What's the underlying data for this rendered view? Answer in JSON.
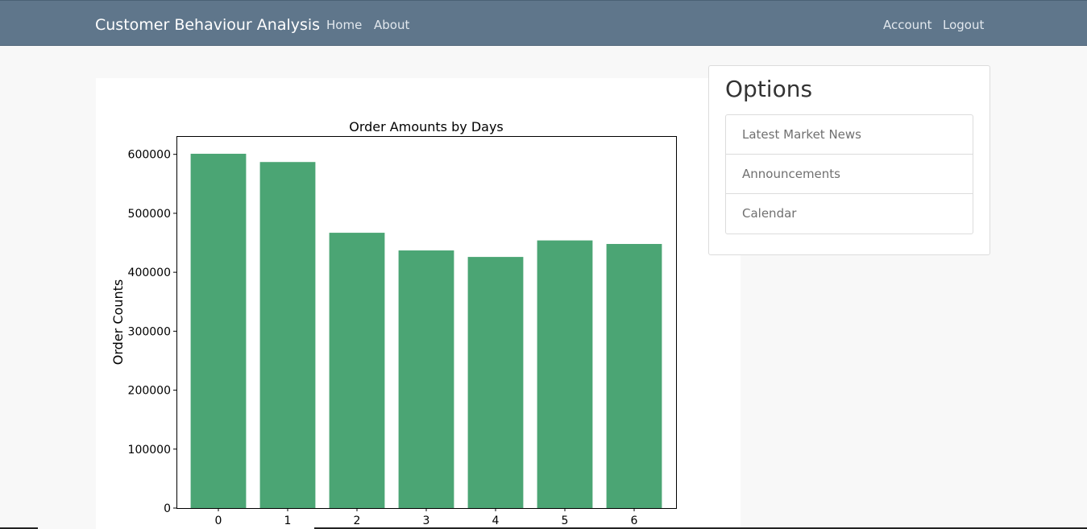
{
  "navbar": {
    "brand": "Customer Behaviour Analysis",
    "links": [
      "Home",
      "About"
    ],
    "right_links": [
      "Account",
      "Logout"
    ]
  },
  "options": {
    "title": "Options",
    "items": [
      "Latest Market News",
      "Announcements",
      "Calendar"
    ]
  },
  "colors": {
    "navbar": "#5f768b",
    "bar": "#4ba574"
  },
  "chart_data": {
    "type": "bar",
    "title": "Order Amounts by Days",
    "xlabel": "",
    "ylabel": "Order Counts",
    "categories": [
      "0",
      "1",
      "2",
      "3",
      "4",
      "5",
      "6"
    ],
    "values": [
      601000,
      587000,
      467000,
      437000,
      426000,
      454000,
      448000
    ],
    "ylim": [
      0,
      631000
    ],
    "yticks": [
      0,
      100000,
      200000,
      300000,
      400000,
      500000,
      600000
    ],
    "ytick_labels": [
      "0",
      "100000",
      "200000",
      "300000",
      "400000",
      "500000",
      "600000"
    ],
    "grid": false,
    "bar_color": "#4ba574"
  }
}
